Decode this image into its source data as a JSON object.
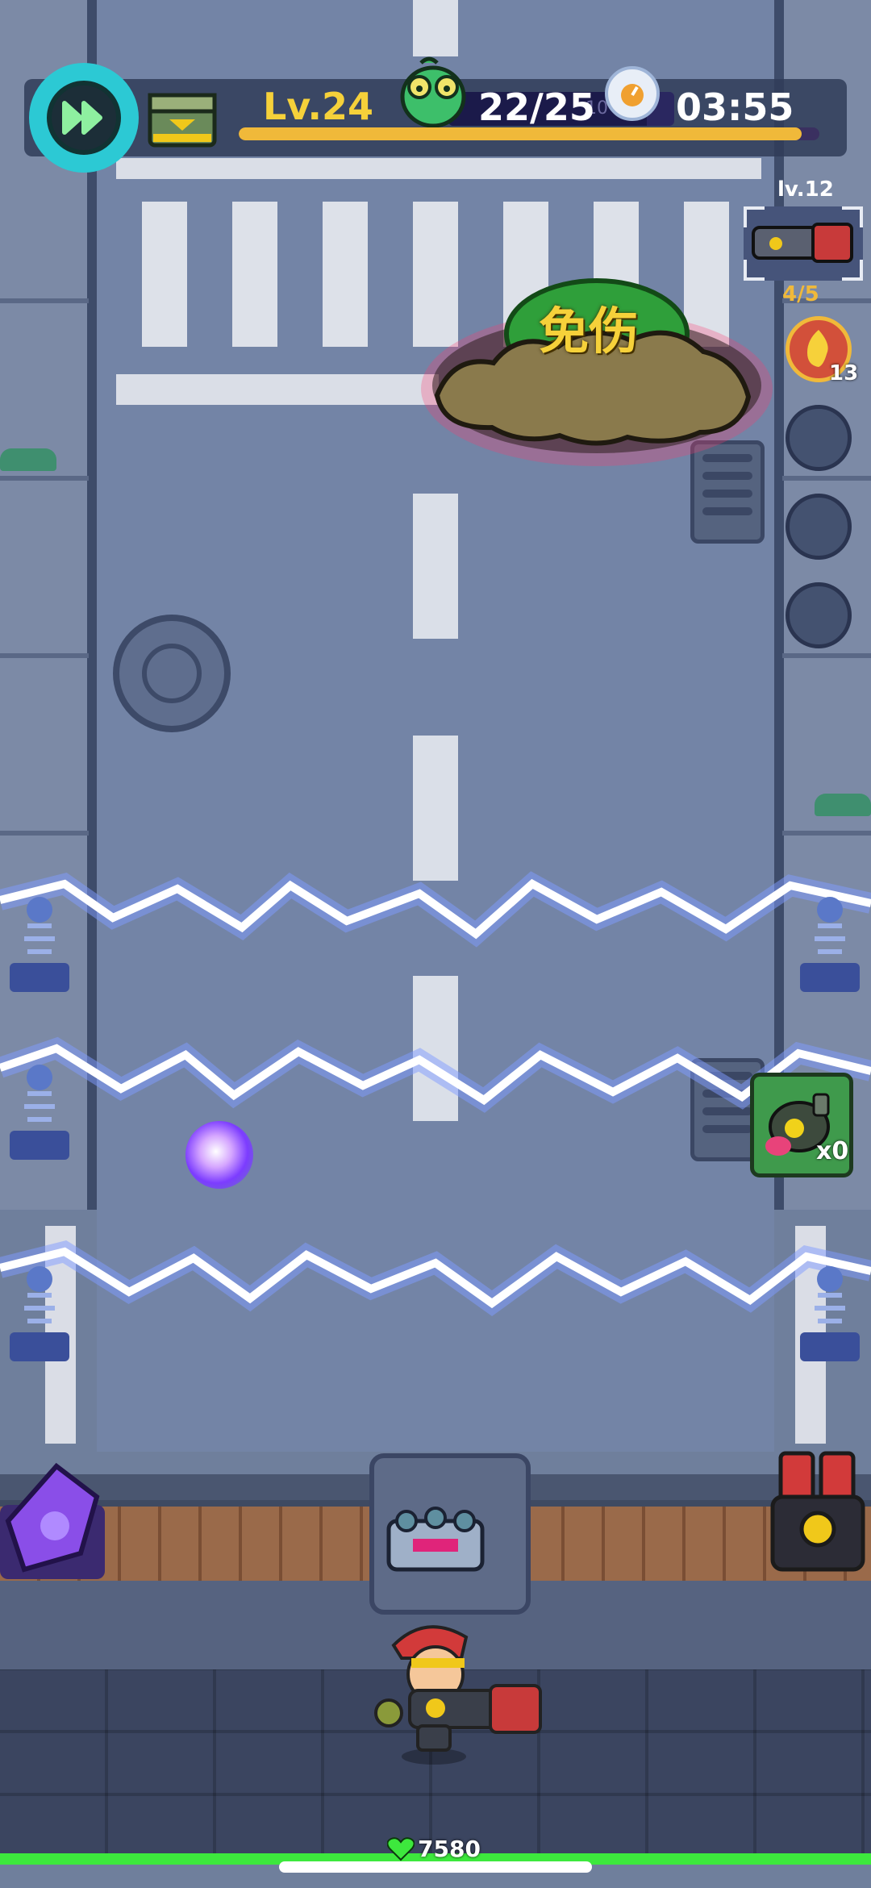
{
  "hud": {
    "level": "Lv.24",
    "level_progress": 0.97,
    "wave": "22/25",
    "wave_ghost": "10",
    "wave_progress": 0.88,
    "timer": "03:55",
    "speed_icon": "fast-forward-icon",
    "chest_icon": "supply-crate-icon"
  },
  "weapon_panel": {
    "weapon_level": "lv.12",
    "ammo": "4/5",
    "skill_count": "13",
    "empty_slots": 3
  },
  "boss": {
    "status_label": "免伤"
  },
  "powerup": {
    "bomb_count": "x0",
    "icon": "radioactive-bomb-icon"
  },
  "player": {
    "hp": "7580",
    "hp_fraction": 1.0,
    "hp_icon": "heart-icon"
  },
  "colors": {
    "level_text": "#f6d13a",
    "xp_fill": "#f0b93a",
    "hp_fill": "#3de83d",
    "speed_button": "#2cc9d4",
    "lightning": "#e8f0ff"
  }
}
